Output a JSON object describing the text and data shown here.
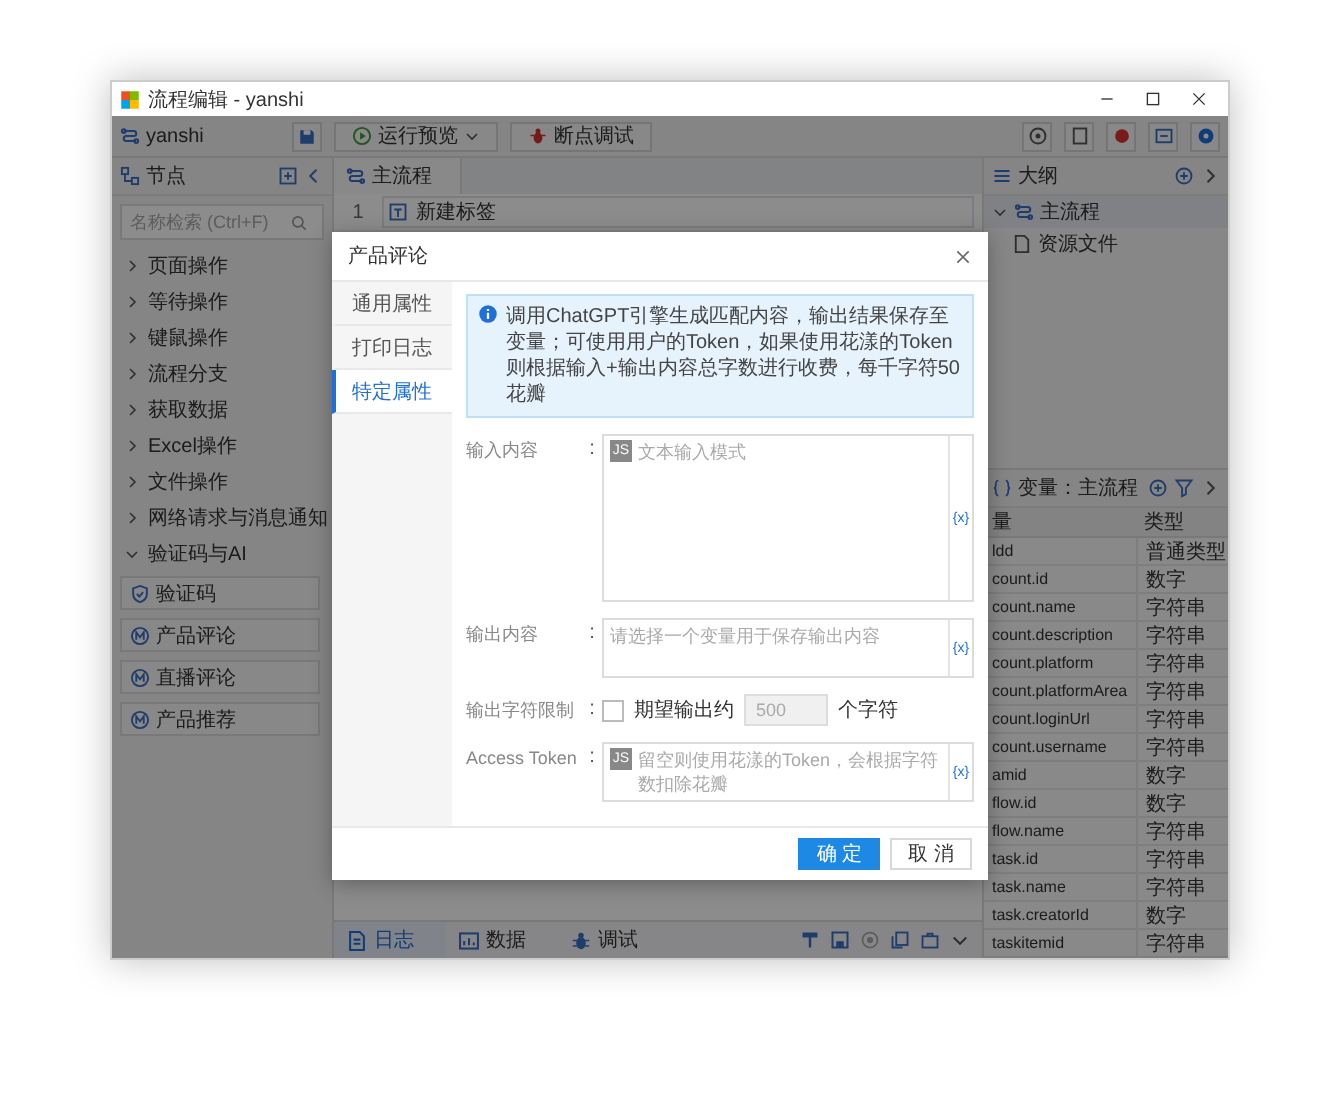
{
  "window": {
    "title": "流程编辑 - yanshi"
  },
  "toolbar": {
    "project": "yanshi",
    "buttons": [
      {
        "label": "运行预览",
        "dropdown": true
      },
      {
        "label": "断点调试",
        "dropdown": false
      }
    ]
  },
  "node_panel": {
    "title": "节点",
    "search": {
      "placeholder": "名称检索 (Ctrl+F)"
    },
    "categories": [
      {
        "label": "页面操作",
        "expanded": false
      },
      {
        "label": "等待操作",
        "expanded": false
      },
      {
        "label": "键鼠操作",
        "expanded": false
      },
      {
        "label": "流程分支",
        "expanded": false
      },
      {
        "label": "获取数据",
        "expanded": false
      },
      {
        "label": "Excel操作",
        "expanded": false
      },
      {
        "label": "文件操作",
        "expanded": false
      },
      {
        "label": "网络请求与消息通知",
        "expanded": false
      },
      {
        "label": "验证码与AI",
        "expanded": true,
        "children": [
          {
            "label": "验证码",
            "kind": "shield"
          },
          {
            "label": "产品评论",
            "kind": "ai"
          },
          {
            "label": "直播评论",
            "kind": "ai"
          },
          {
            "label": "产品推荐",
            "kind": "ai"
          }
        ]
      }
    ]
  },
  "editor": {
    "tab": "主流程",
    "rows": [
      {
        "number": "1",
        "label": "新建标签"
      }
    ],
    "bottom_tabs": [
      {
        "label": "日志",
        "kind": "log",
        "selected": true
      },
      {
        "label": "数据",
        "kind": "data",
        "selected": false
      },
      {
        "label": "调试",
        "kind": "debug",
        "selected": false
      }
    ]
  },
  "outline": {
    "title": "大纲",
    "items": [
      {
        "label": "主流程",
        "expanded": true,
        "children": [
          {
            "label": "资源文件"
          }
        ]
      }
    ]
  },
  "variables": {
    "title": "变量：主流程",
    "columns": [
      "量",
      "类型"
    ],
    "rows": [
      {
        "name": "ldd",
        "type": "普通类型"
      },
      {
        "name": "count.id",
        "type": "数字"
      },
      {
        "name": "count.name",
        "type": "字符串"
      },
      {
        "name": "count.description",
        "type": "字符串"
      },
      {
        "name": "count.platform",
        "type": "字符串"
      },
      {
        "name": "count.platformArea",
        "type": "字符串"
      },
      {
        "name": "count.loginUrl",
        "type": "字符串"
      },
      {
        "name": "count.username",
        "type": "字符串"
      },
      {
        "name": "amid",
        "type": "数字"
      },
      {
        "name": "flow.id",
        "type": "数字"
      },
      {
        "name": "flow.name",
        "type": "字符串"
      },
      {
        "name": "task.id",
        "type": "字符串"
      },
      {
        "name": "task.name",
        "type": "字符串"
      },
      {
        "name": "task.creatorId",
        "type": "数字"
      },
      {
        "name": "taskitemid",
        "type": "字符串"
      }
    ]
  },
  "dialog": {
    "title": "产品评论",
    "tabs": [
      {
        "label": "通用属性",
        "selected": false
      },
      {
        "label": "打印日志",
        "selected": false
      },
      {
        "label": "特定属性",
        "selected": true
      }
    ],
    "notice": "调用ChatGPT引擎生成匹配内容，输出结果保存至变量；可使用用户的Token，如果使用花漾的Token则根据输入+输出内容总字数进行收费，每千字符50花瓣",
    "fields": [
      {
        "kind": "multiline",
        "label": "输入内容",
        "separator": ":",
        "badge": "JS",
        "placeholder": "文本输入模式",
        "variable_button": "{x}"
      },
      {
        "kind": "line",
        "label": "输出内容",
        "separator": ":",
        "placeholder": "请选择一个变量用于保存输出内容",
        "variable_button": "{x}"
      },
      {
        "kind": "limit",
        "label": "输出字符限制",
        "separator": ":",
        "checked": false,
        "prefix": "期望输出约",
        "value": "500",
        "disabled": true,
        "suffix": "个字符"
      },
      {
        "kind": "line",
        "label": "Access Token",
        "separator": ":",
        "badge": "JS",
        "placeholder": "留空则使用花漾的Token，会根据字符数扣除花瓣",
        "variable_button": "{x}"
      }
    ],
    "buttons": [
      {
        "label": "确 定",
        "kind": "primary"
      },
      {
        "label": "取 消",
        "kind": "default"
      }
    ]
  }
}
